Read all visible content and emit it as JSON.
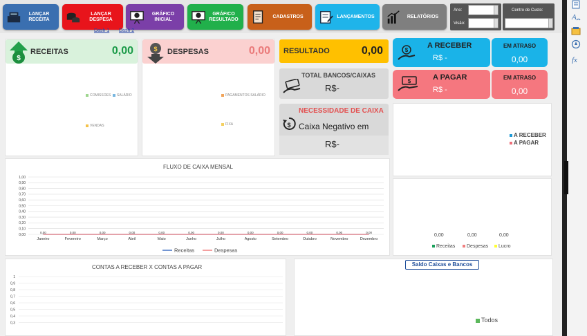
{
  "toolbar": {
    "buttons": [
      {
        "label": "Lançar Receita",
        "icon": "cash-register-icon",
        "color": "#3a6fb0"
      },
      {
        "label": "Lançar Despesa",
        "icon": "coins-icon",
        "color": "#e8141b"
      },
      {
        "label": "Gráfico Inicial",
        "icon": "presentation-icon",
        "color": "#7b3fa8"
      },
      {
        "label": "Gráfico Resultado",
        "icon": "chart-board-icon",
        "color": "#21b04b"
      },
      {
        "label": "Cadastros",
        "icon": "registration-icon",
        "color": "#c8601a"
      },
      {
        "label": "Lançamentos",
        "icon": "entries-icon",
        "color": "#1fb4ea"
      },
      {
        "label": "Relatórios",
        "icon": "report-icon",
        "color": "#7f7f7f"
      }
    ],
    "ano_label": "Ano:",
    "visao_label": "Visão:",
    "centro_label": "Centro de Custo:"
  },
  "links": [
    "Dash 1",
    "Dash 2"
  ],
  "receitas": {
    "label": "RECEITAS",
    "value": "0,00"
  },
  "despesas": {
    "label": "DESPESAS",
    "value": "0,00"
  },
  "resultado": {
    "label": "RESULTADO",
    "value": "0,00"
  },
  "a_receber": {
    "label": "A RECEBER",
    "value": "R$ -",
    "atraso_label": "EM ATRASO",
    "atraso_value": "0,00"
  },
  "a_pagar": {
    "label": "A PAGAR",
    "value": "R$ -",
    "atraso_label": "EM ATRASO",
    "atraso_value": "0,00"
  },
  "total_bancos": {
    "label": "TOTAL BANCOS/CAIXAS",
    "value": "R$-"
  },
  "necessidade": {
    "label": "NECESSIDADE DE CAIXA",
    "sub": "Caixa Negativo em",
    "value": "R$-"
  },
  "receitas_pie_legend": [
    "COMISSOES",
    "SALÁRIO",
    "VENDAS"
  ],
  "despesas_pie_legend": [
    "PAGAMENTOS SALÁRIO",
    "FIXA"
  ],
  "receber_pagar_legend": [
    "A RECEBER",
    "A PAGAR"
  ],
  "colors": {
    "receber": "#1f9ad6",
    "pagar": "#ef6f7a",
    "receitas_line": "#4472c4",
    "despesas_line": "#f08080",
    "lucro": "#ffff33",
    "receitas_bar": "#1aa05a"
  },
  "resumo": {
    "values": [
      "0,00",
      "0,00",
      "0,00"
    ],
    "legend": [
      "Receitas",
      "Despesas",
      "Lucro"
    ]
  },
  "saldo_caixas": {
    "title": "Saldo Caixas e Bancos",
    "legend": "Todos"
  },
  "chart_data": [
    {
      "type": "line",
      "title": "FLUXO DE CAIXA MENSAL",
      "categories": [
        "Janeiro",
        "Fevereiro",
        "Março",
        "Abril",
        "Maio",
        "Junho",
        "Julho",
        "Agosto",
        "Setembro",
        "Outubro",
        "Novembro",
        "Dezembro"
      ],
      "series": [
        {
          "name": "Receitas",
          "values": [
            0,
            0,
            0,
            0,
            0,
            0,
            0,
            0,
            0,
            0,
            0,
            0
          ]
        },
        {
          "name": "Despesas",
          "values": [
            0,
            0,
            0,
            0,
            0,
            0,
            0,
            0,
            0,
            0,
            0,
            0
          ]
        }
      ],
      "data_labels": [
        "0,00",
        "0,00",
        "0,00",
        "0,00",
        "0,00",
        "0,00",
        "0,00",
        "0,00",
        "0,00",
        "0,00",
        "0,00",
        "0,00"
      ],
      "yticks": [
        "0,00",
        "0,10",
        "0,20",
        "0,30",
        "0,40",
        "0,50",
        "0,60",
        "0,70",
        "0,80",
        "0,90",
        "1,00"
      ],
      "ylim": [
        0,
        1
      ]
    },
    {
      "type": "bar",
      "title": "CONTAS A RECEBER X CONTAS A PAGAR",
      "yticks": [
        "1",
        "0,9",
        "0,8",
        "0,7",
        "0,6",
        "0,5",
        "0,4",
        "0,3"
      ],
      "ylim": [
        0,
        1
      ]
    }
  ]
}
